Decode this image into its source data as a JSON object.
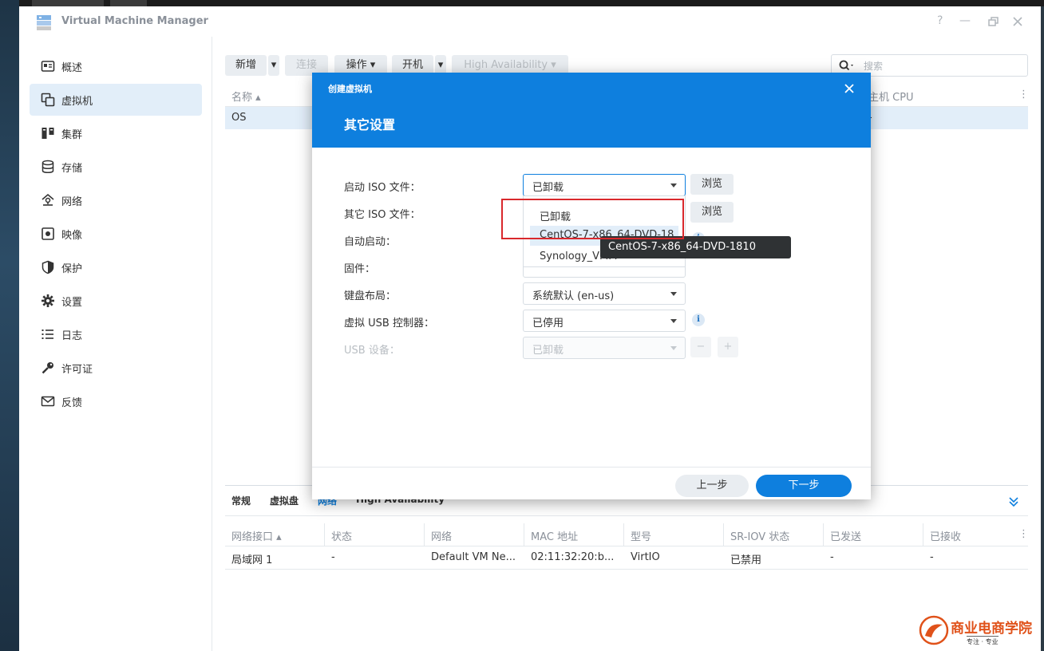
{
  "window": {
    "title": "Virtual Machine Manager",
    "help_icon": "question-icon",
    "min_icon": "minimize-icon",
    "max_icon": "restore-icon",
    "close_icon": "close-icon"
  },
  "sidebar": {
    "items": [
      {
        "label": "概述",
        "icon": "overview-icon"
      },
      {
        "label": "虚拟机",
        "icon": "vm-icon"
      },
      {
        "label": "集群",
        "icon": "cluster-icon"
      },
      {
        "label": "存储",
        "icon": "storage-icon"
      },
      {
        "label": "网络",
        "icon": "network-icon"
      },
      {
        "label": "映像",
        "icon": "image-icon"
      },
      {
        "label": "保护",
        "icon": "shield-icon"
      },
      {
        "label": "设置",
        "icon": "gear-icon"
      },
      {
        "label": "日志",
        "icon": "list-icon"
      },
      {
        "label": "许可证",
        "icon": "key-icon"
      },
      {
        "label": "反馈",
        "icon": "mail-icon"
      }
    ],
    "active": "虚拟机"
  },
  "toolbar": {
    "new": "新增",
    "connect": "连接",
    "action": "操作",
    "power_on": "开机",
    "ha": "High Availability",
    "search_placeholder": "搜索"
  },
  "vm_grid": {
    "col_name": "名称",
    "col_host_cpu": "主机 CPU",
    "row_name": "OS",
    "row_host_cpu": "-"
  },
  "bottom": {
    "tabs": [
      "常规",
      "虚拟盘",
      "网络",
      "High Availability"
    ],
    "columns": [
      "网络接口",
      "状态",
      "网络",
      "MAC 地址",
      "型号",
      "SR-IOV 状态",
      "已发送",
      "已接收"
    ],
    "row": [
      "局域网 1",
      "-",
      "Default VM Ne...",
      "02:11:32:20:b...",
      "VirtIO",
      "已禁用",
      "-",
      "-"
    ]
  },
  "dialog": {
    "header_small": "创建虚拟机",
    "title": "其它设置",
    "fields": {
      "boot_iso": {
        "label": "启动 ISO 文件：",
        "value": "已卸载"
      },
      "other_iso": {
        "label": "其它 ISO 文件："
      },
      "autostart": {
        "label": "自动启动："
      },
      "firmware": {
        "label": "固件："
      },
      "keyboard": {
        "label": "键盘布局：",
        "value": "系统默认 (en-us)"
      },
      "usb_controller": {
        "label": "虚拟 USB 控制器：",
        "value": "已停用"
      },
      "usb_device": {
        "label": "USB 设备：",
        "value": "已卸载"
      }
    },
    "browse": "浏览",
    "dropdown_options": [
      "已卸载",
      "CentOS-7-x86_64-DVD-18",
      "Synology_VMM"
    ],
    "tooltip": "CentOS-7-x86_64-DVD-1810",
    "prev": "上一步",
    "next": "下一步"
  },
  "watermark": {
    "name": "商业电商学院",
    "tagline": "专注 · 专业"
  },
  "colors": {
    "accent": "#0e7fde",
    "selected_row": "#e2eef9",
    "highlight_box": "#d9282c"
  }
}
